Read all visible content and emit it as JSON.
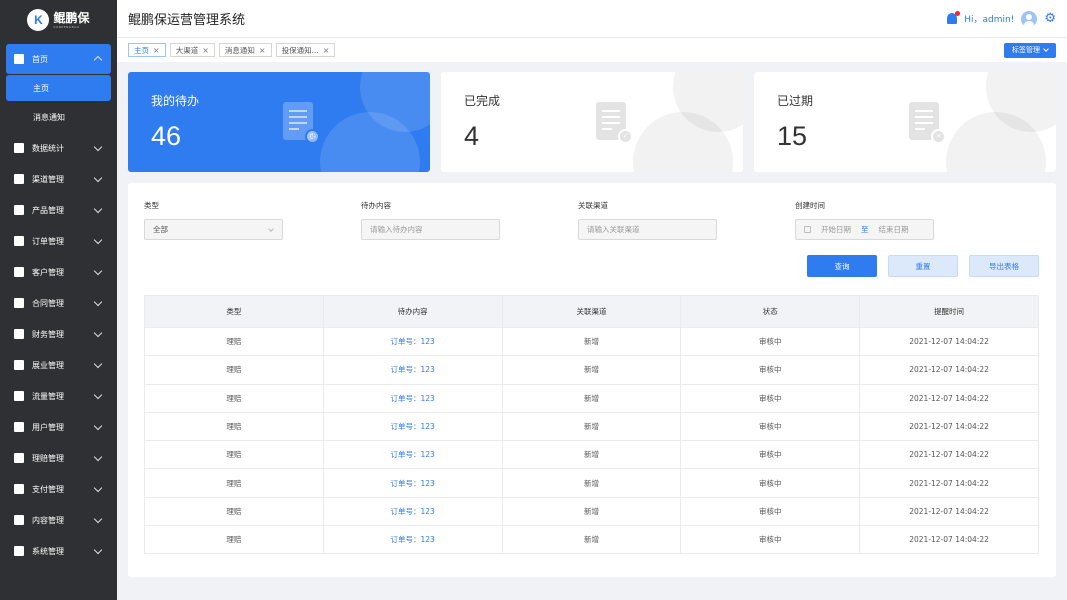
{
  "app": {
    "logo_cn": "鲲鹏保",
    "logo_en": "KUNPENGBAO",
    "title": "鲲鹏保运营管理系统",
    "greeting": "Hi，admin!"
  },
  "sidebar": {
    "items": [
      {
        "label": "首页",
        "expanded": true,
        "children": [
          "主页",
          "消息通知"
        ]
      },
      {
        "label": "数据统计"
      },
      {
        "label": "渠道管理"
      },
      {
        "label": "产品管理"
      },
      {
        "label": "订单管理"
      },
      {
        "label": "客户管理"
      },
      {
        "label": "合同管理"
      },
      {
        "label": "财务管理"
      },
      {
        "label": "展业管理"
      },
      {
        "label": "流量管理"
      },
      {
        "label": "用户管理"
      },
      {
        "label": "理赔管理"
      },
      {
        "label": "支付管理"
      },
      {
        "label": "内容管理"
      },
      {
        "label": "系统管理"
      }
    ]
  },
  "tabs": [
    "主页",
    "大渠道",
    "消息通知",
    "投保通知..."
  ],
  "tag_manage": "标签管理",
  "stats": [
    {
      "label": "我的待办",
      "value": "46",
      "badge": "clock"
    },
    {
      "label": "已完成",
      "value": "4",
      "badge": "check"
    },
    {
      "label": "已过期",
      "value": "15",
      "badge": "cross"
    }
  ],
  "filters": {
    "type_label": "类型",
    "type_value": "全部",
    "content_label": "待办内容",
    "content_placeholder": "请输入待办内容",
    "channel_label": "关联渠道",
    "channel_placeholder": "请输入关联渠道",
    "time_label": "创建时间",
    "start_placeholder": "开始日期",
    "range_sep": "至",
    "end_placeholder": "结束日期"
  },
  "buttons": {
    "search": "查询",
    "reset": "重置",
    "export": "导出表格"
  },
  "table": {
    "headers": [
      "类型",
      "待办内容",
      "关联渠道",
      "状态",
      "提醒时间"
    ],
    "rows": [
      [
        "理赔",
        "订单号：123",
        "新增",
        "审核中",
        "2021-12-07 14:04:22"
      ],
      [
        "理赔",
        "订单号：123",
        "新增",
        "审核中",
        "2021-12-07 14:04:22"
      ],
      [
        "理赔",
        "订单号：123",
        "新增",
        "审核中",
        "2021-12-07 14:04:22"
      ],
      [
        "理赔",
        "订单号：123",
        "新增",
        "审核中",
        "2021-12-07 14:04:22"
      ],
      [
        "理赔",
        "订单号：123",
        "新增",
        "审核中",
        "2021-12-07 14:04:22"
      ],
      [
        "理赔",
        "订单号：123",
        "新增",
        "审核中",
        "2021-12-07 14:04:22"
      ],
      [
        "理赔",
        "订单号：123",
        "新增",
        "审核中",
        "2021-12-07 14:04:22"
      ],
      [
        "理赔",
        "订单号：123",
        "新增",
        "审核中",
        "2021-12-07 14:04:22"
      ]
    ]
  },
  "colors": {
    "accent": "#2f7bf0",
    "sidebar": "#2f3033",
    "background": "#f0f2f5"
  }
}
